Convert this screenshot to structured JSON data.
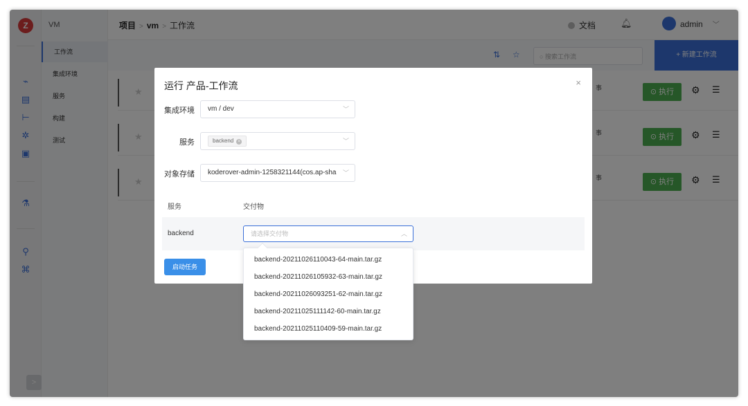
{
  "rail": {
    "logo": "Z",
    "expand": ">"
  },
  "submenu": {
    "title": "VM",
    "items": [
      "工作流",
      "集成环境",
      "服务",
      "构建",
      "测试"
    ]
  },
  "header": {
    "crumb_project": "项目",
    "crumb_sep": ">",
    "crumb_vm": "vm",
    "crumb_workflow": "工作流",
    "docs": "文档",
    "user": "admin"
  },
  "toolbar": {
    "search_placeholder": "搜索工作流",
    "new_label": "+ 新建工作流"
  },
  "rows": {
    "run_label": "执行",
    "row_text": "事"
  },
  "modal": {
    "title": "运行 产品-工作流",
    "close": "×",
    "env_label": "集成环境",
    "env_value": "vm / dev",
    "service_label": "服务",
    "service_tag": "backend",
    "storage_label": "对象存储",
    "storage_value": "koderover-admin-1258321144(cos.ap-sha",
    "col_service": "服务",
    "col_artifact": "交付物",
    "row_service": "backend",
    "artifact_placeholder": "请选择交付物",
    "start_label": "启动任务"
  },
  "dropdown": {
    "options": [
      "backend-20211026110043-64-main.tar.gz",
      "backend-20211026105932-63-main.tar.gz",
      "backend-20211026093251-62-main.tar.gz",
      "backend-20211025111142-60-main.tar.gz",
      "backend-20211025110409-59-main.tar.gz"
    ]
  },
  "colors": {
    "primary": "#3a6fd8",
    "run_green": "#4caf50",
    "logo_red": "#d83b3b"
  },
  "icons": {
    "rail": [
      "monitor-icon",
      "folder-icon",
      "tree-icon",
      "cluster-icon",
      "terminal-icon",
      "flask-icon",
      "users-icon",
      "command-icon"
    ]
  }
}
